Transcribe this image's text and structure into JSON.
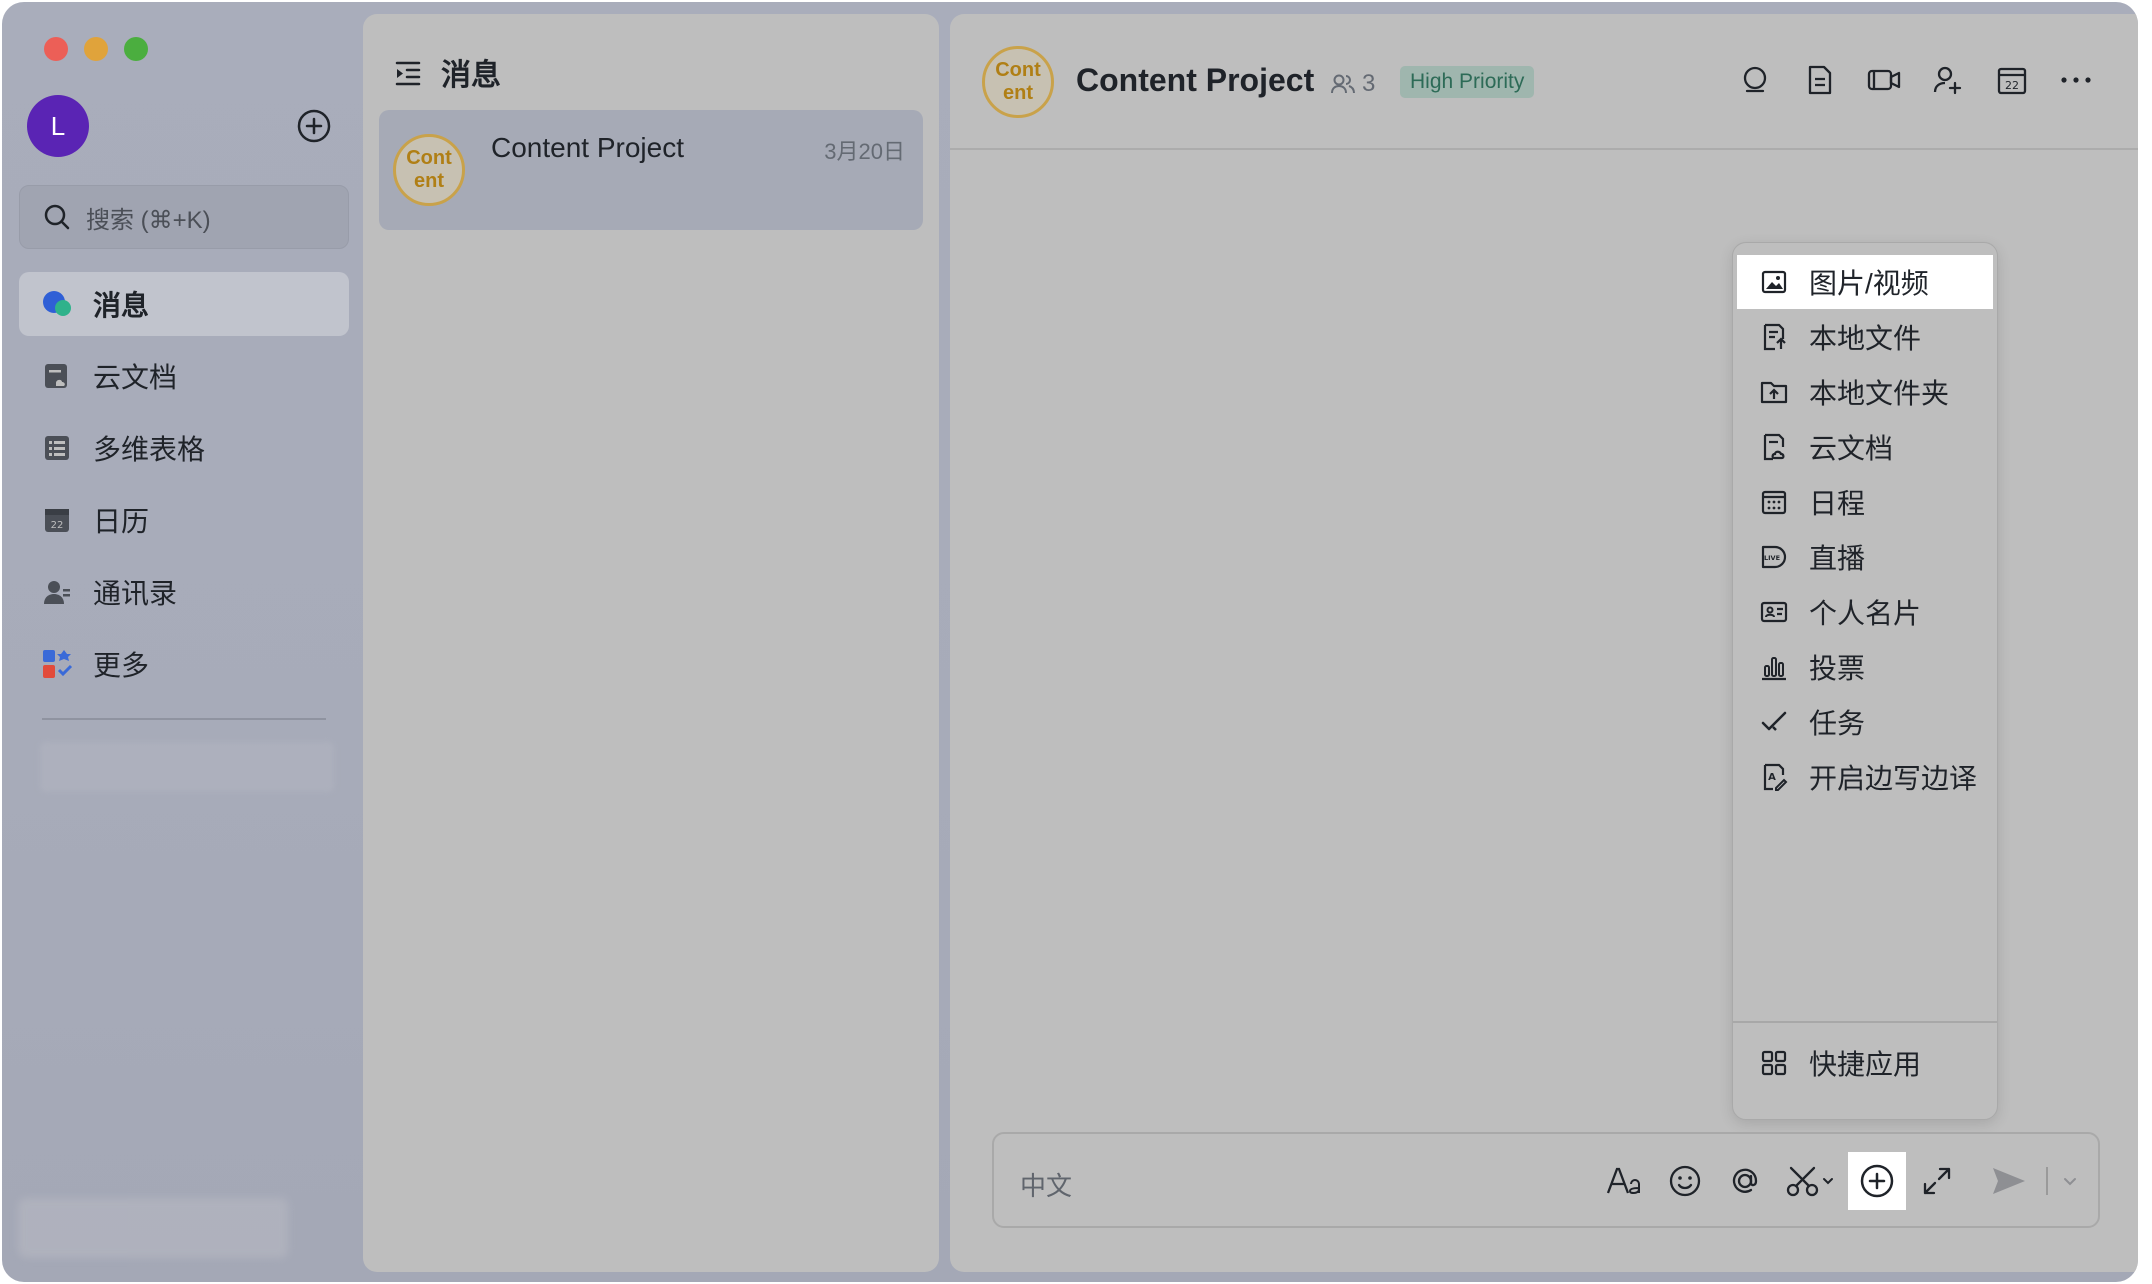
{
  "sidebar": {
    "avatar_initial": "L",
    "search_placeholder": "搜索 (⌘+K)",
    "nav": [
      {
        "label": "消息",
        "icon": "messages-icon",
        "active": true
      },
      {
        "label": "云文档",
        "icon": "cloud-docs-icon"
      },
      {
        "label": "多维表格",
        "icon": "base-table-icon"
      },
      {
        "label": "日历",
        "icon": "calendar-icon"
      },
      {
        "label": "通讯录",
        "icon": "contacts-icon"
      },
      {
        "label": "更多",
        "icon": "more-apps-icon"
      }
    ]
  },
  "middle": {
    "title": "消息",
    "conversation": {
      "avatar_text": "Cont ent",
      "name": "Content Project",
      "date": "3月20日"
    }
  },
  "chat": {
    "avatar_text": "Cont ent",
    "title": "Content Project",
    "member_count": "3",
    "tag": "High Priority",
    "input_placeholder": "中文"
  },
  "menu": {
    "items": [
      {
        "label": "图片/视频",
        "icon": "image-video-icon"
      },
      {
        "label": "本地文件",
        "icon": "local-file-icon"
      },
      {
        "label": "本地文件夹",
        "icon": "local-folder-icon"
      },
      {
        "label": "云文档",
        "icon": "cloud-doc-icon"
      },
      {
        "label": "日程",
        "icon": "schedule-icon"
      },
      {
        "label": "直播",
        "icon": "live-icon"
      },
      {
        "label": "个人名片",
        "icon": "contact-card-icon"
      },
      {
        "label": "投票",
        "icon": "vote-icon"
      },
      {
        "label": "任务",
        "icon": "task-icon"
      },
      {
        "label": "开启边写边译",
        "icon": "translate-icon"
      }
    ],
    "quick_apps": {
      "label": "快捷应用",
      "icon": "quick-apps-icon"
    }
  },
  "colors": {
    "avatar": "#5a24b4",
    "group_avatar_border": "#c9a24a",
    "group_avatar_text": "#b07f15",
    "priority_bg": "#9fb6ae",
    "priority_text": "#2d6b57"
  }
}
